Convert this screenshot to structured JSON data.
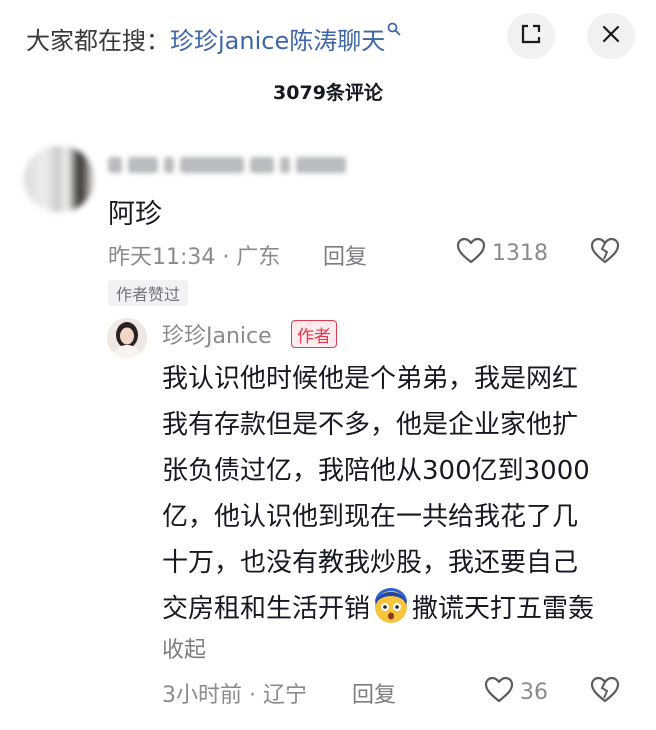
{
  "header": {
    "search_prefix": "大家都在搜：",
    "search_query": "珍珍janice陈涛聊天",
    "search_icon": "search-icon",
    "collapse_icon": "minimize-icon",
    "close_icon": "close-icon"
  },
  "comments_count": "3079条评论",
  "comment": {
    "text": "阿珍",
    "meta": "昨天11:34 · 广东",
    "reply_label": "回复",
    "likes": "1318",
    "author_liked_badge": "作者赞过"
  },
  "reply": {
    "name": "珍珍Janice",
    "author_tag": "作者",
    "lines": [
      "我认识他时候他是个弟弟，我是网红",
      "我有存款但是不多，他是企业家他扩",
      "张负债过亿，我陪他从300亿到3000",
      "亿，他认识他到现在一共给我花了几",
      "十万，也没有教我炒股，我还要自己"
    ],
    "last_line_before_emoji": "交房租和生活开销",
    "last_line_after_emoji": "撒谎天打五雷轰",
    "emoji": "shocked-face-emoji",
    "collapse_label": "收起",
    "meta": "3小时前 · 辽宁",
    "reply_label": "回复",
    "likes": "36"
  },
  "colors": {
    "link_blue": "#3f66a8",
    "author_red": "#e23a4f",
    "meta_gray": "#8a8b91",
    "text_dark": "#161823"
  }
}
